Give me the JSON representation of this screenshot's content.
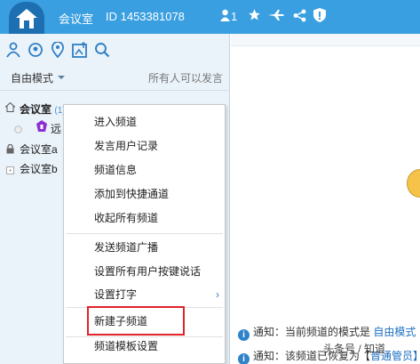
{
  "titlebar": {
    "room_name": "会议室",
    "room_id": "ID 1453381078",
    "online_count": "1",
    "icons": [
      "home-logo-icon",
      "user-icon",
      "star-icon",
      "airplane-icon",
      "share-icon",
      "shield-icon"
    ]
  },
  "toolbar": {
    "icons": [
      "user-group-icon",
      "refresh-user-icon",
      "location-icon",
      "image-upload-icon",
      "search-icon"
    ]
  },
  "mode": {
    "selected": "自由模式",
    "note": "所有人可以发言"
  },
  "channels": [
    {
      "label": "会议室",
      "badge": "(1)"
    },
    {
      "label": "远",
      "role": "user"
    },
    {
      "label": "会议室a"
    },
    {
      "label": "会议室b"
    }
  ],
  "context_menu": {
    "items": [
      "进入频道",
      "发言用户记录",
      "频道信息",
      "添加到快捷通道",
      "收起所有频道",
      "发送频道广播",
      "设置所有用户按键说话",
      "设置打字",
      "新建子频道",
      "频道模板设置"
    ]
  },
  "notices": [
    {
      "prefix": "通知：当前频道的模式是 ",
      "highlight": "自由模式"
    },
    {
      "prefix": "通知：该频道已恢复为【",
      "highlight": "普通管员】"
    }
  ],
  "watermark": "头条号 / 知道",
  "colors": {
    "titlebar": "#3a9fe0",
    "logo": "#1d6fb1",
    "panel": "#eaf3fa",
    "highlight_border": "#e0232b",
    "link_blue": "#1e6fbf"
  }
}
